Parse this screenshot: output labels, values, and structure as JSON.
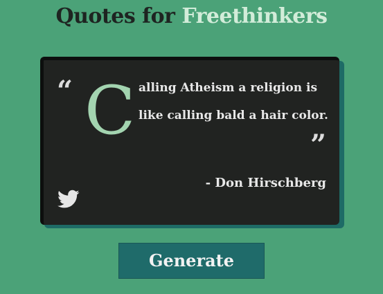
{
  "header": {
    "title_part1": "Quotes for ",
    "title_part2": "Freethinkers"
  },
  "quote": {
    "open_mark": "“",
    "close_mark": "”",
    "drop_cap": "C",
    "line1": "alling Atheism a religion is",
    "line2": "like calling bald a hair color.",
    "author": "- Don Hirschberg"
  },
  "share": {
    "icon": "twitter-icon"
  },
  "actions": {
    "generate_label": "Generate"
  },
  "colors": {
    "background": "#4ba278",
    "card": "#212321",
    "card_shadow": "#1e6b66",
    "accent_light": "#a3d4b0",
    "button": "#1f6b6a"
  }
}
